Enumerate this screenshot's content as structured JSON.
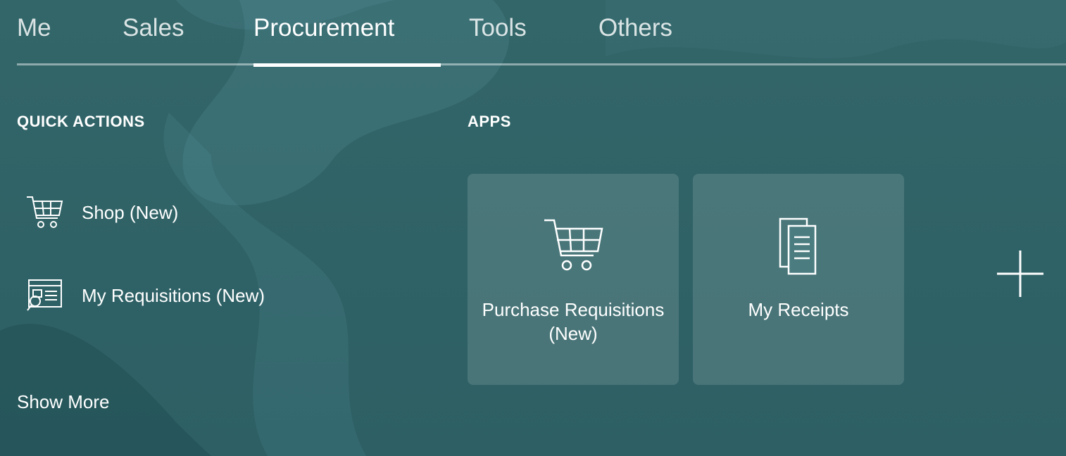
{
  "tabs": [
    {
      "label": "Me"
    },
    {
      "label": "Sales"
    },
    {
      "label": "Procurement"
    },
    {
      "label": "Tools"
    },
    {
      "label": "Others"
    }
  ],
  "active_tab": "Procurement",
  "quick_actions": {
    "title": "QUICK ACTIONS",
    "items": [
      {
        "label": "Shop (New)",
        "icon": "shopping-cart-icon"
      },
      {
        "label": "My Requisitions (New)",
        "icon": "requisition-search-icon"
      }
    ],
    "show_more": "Show More"
  },
  "apps": {
    "title": "APPS",
    "tiles": [
      {
        "label": "Purchase Requisitions (New)",
        "icon": "shopping-cart-icon"
      },
      {
        "label": "My Receipts",
        "icon": "documents-icon"
      }
    ],
    "add_icon": "plus-icon"
  },
  "colors": {
    "background": "#2f6166",
    "text": "#ffffff",
    "tile_background": "rgba(255,255,255,0.13)"
  }
}
